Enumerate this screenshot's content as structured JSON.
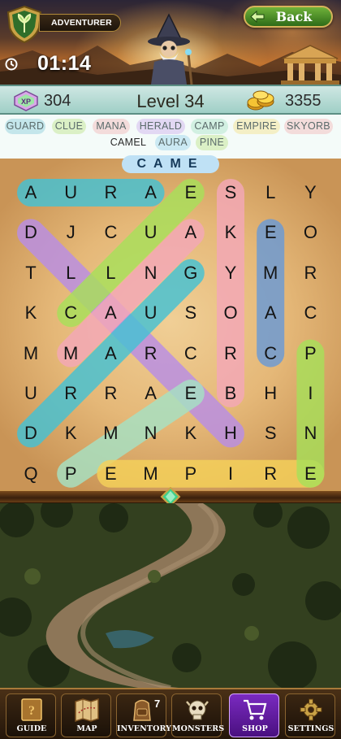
{
  "header": {
    "rank": "ADVENTURER",
    "back_label": "Back",
    "timer": "01:14"
  },
  "status": {
    "xp_badge": "XP",
    "xp": "304",
    "level": "Level 34",
    "coins": "3355"
  },
  "words": [
    {
      "text": "GUARD",
      "found": true,
      "color": "#7ec8d8"
    },
    {
      "text": "CLUE",
      "found": true,
      "color": "#b6e27a"
    },
    {
      "text": "MANA",
      "found": true,
      "color": "#f2b0b0"
    },
    {
      "text": "HERALD",
      "found": true,
      "color": "#c9a6ea"
    },
    {
      "text": "CAMP",
      "found": true,
      "color": "#9fe0c0"
    },
    {
      "text": "EMPIRE",
      "found": true,
      "color": "#f6de7a"
    },
    {
      "text": "SKYORB",
      "found": true,
      "color": "#f2b0b0"
    },
    {
      "text": "CAMEL",
      "found": false,
      "color": ""
    },
    {
      "text": "AURA",
      "found": true,
      "color": "#8fd0ea"
    },
    {
      "text": "PINE",
      "found": true,
      "color": "#b6e27a"
    }
  ],
  "current_selection": "CAME",
  "grid": [
    [
      "A",
      "U",
      "R",
      "A",
      "E",
      "S",
      "L",
      "Y"
    ],
    [
      "D",
      "J",
      "C",
      "U",
      "A",
      "K",
      "E",
      "O"
    ],
    [
      "T",
      "L",
      "L",
      "N",
      "G",
      "Y",
      "M",
      "R"
    ],
    [
      "K",
      "C",
      "A",
      "U",
      "S",
      "O",
      "A",
      "C"
    ],
    [
      "M",
      "M",
      "A",
      "R",
      "C",
      "R",
      "C",
      "P"
    ],
    [
      "U",
      "R",
      "R",
      "A",
      "E",
      "B",
      "H",
      "I"
    ],
    [
      "D",
      "K",
      "M",
      "N",
      "K",
      "H",
      "S",
      "N"
    ],
    [
      "Q",
      "P",
      "E",
      "M",
      "P",
      "I",
      "R",
      "E"
    ]
  ],
  "found_paths": [
    {
      "word": "AURA",
      "from": [
        0,
        0
      ],
      "to": [
        0,
        3
      ],
      "color": "#45c2d4"
    },
    {
      "word": "HERALD",
      "from": [
        6,
        5
      ],
      "to": [
        1,
        0
      ],
      "color": "#b98ee6"
    },
    {
      "word": "GUARD",
      "from": [
        2,
        4
      ],
      "to": [
        6,
        0
      ],
      "color": "#45c2d4"
    },
    {
      "word": "CLUE",
      "from": [
        3,
        1
      ],
      "to": [
        0,
        4
      ],
      "color": "#a8e05a"
    },
    {
      "word": "MANA",
      "from": [
        4,
        1
      ],
      "to": [
        1,
        4
      ],
      "color": "#f4a8b8"
    },
    {
      "word": "CAMP",
      "from": [
        5,
        4
      ],
      "to": [
        7,
        1
      ],
      "color": "#a6e2c4"
    },
    {
      "word": "SKYORB",
      "from": [
        0,
        5
      ],
      "to": [
        5,
        5
      ],
      "color": "#f4a8b8"
    },
    {
      "word": "EMPIRE",
      "from": [
        7,
        2
      ],
      "to": [
        7,
        7
      ],
      "color": "#f6d25a"
    },
    {
      "word": "CAMEL",
      "from": [
        4,
        6
      ],
      "to": [
        1,
        6
      ],
      "color": "#6a9ad6"
    },
    {
      "word": "PINE",
      "from": [
        4,
        7
      ],
      "to": [
        7,
        7
      ],
      "color": "#a8e05a"
    }
  ],
  "nav": {
    "items": [
      {
        "label": "GUIDE",
        "icon": "book-icon",
        "active": false
      },
      {
        "label": "MAP",
        "icon": "map-icon",
        "active": false
      },
      {
        "label": "INVENTORY",
        "icon": "backpack-icon",
        "active": false,
        "count": "7"
      },
      {
        "label": "MONSTERS",
        "icon": "skull-icon",
        "active": false
      },
      {
        "label": "SHOP",
        "icon": "cart-icon",
        "active": true
      },
      {
        "label": "SETTINGS",
        "icon": "gear-icon",
        "active": false
      }
    ]
  }
}
